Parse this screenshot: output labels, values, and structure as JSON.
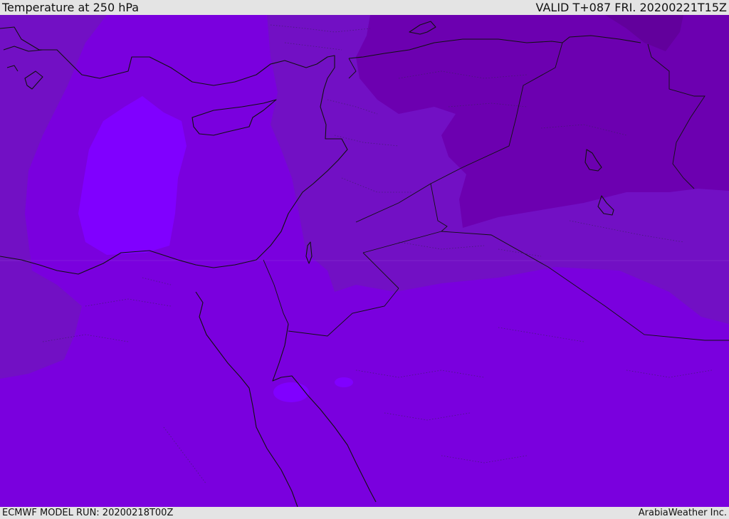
{
  "header": {
    "title": "Temperature at 250 hPa",
    "valid": "VALID T+087 FRI. 20200221T15Z"
  },
  "footer": {
    "model_run": "ECMWF MODEL RUN: 20200218T00Z",
    "credit": "ArabiaWeather Inc."
  },
  "colors": {
    "warmest": "#8000ff",
    "warm": "#7a00de",
    "mid": "#7210c4",
    "cool": "#6c00b0",
    "coldest": "#62009c",
    "background_bar": "#e4e4e4"
  }
}
